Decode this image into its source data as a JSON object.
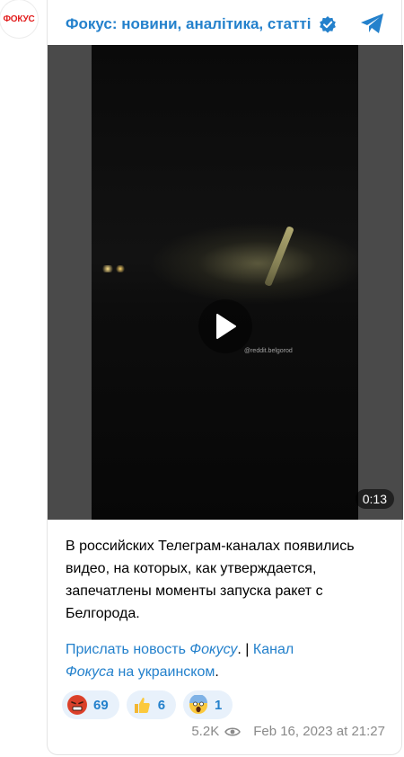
{
  "avatar": {
    "label": "ФОКУС"
  },
  "channel": {
    "title": "Фокус: новини, аналітика, статті",
    "verified_icon": "verified-check-icon",
    "share_icon": "telegram-share-icon"
  },
  "video": {
    "duration": "0:13",
    "watermark": "@reddit.belgorod"
  },
  "post": {
    "text": "В российских Телеграм-каналах появились видео, на которых, как утверждается, запечатлены моменты запуска ракет с Белгорода.",
    "link1_a": "Прислать новость ",
    "link1_b": "Фокусу",
    "sep": ". | ",
    "link2_a": "Канал",
    "link2_b": "Фокуса",
    "link2_c": " на украинском",
    "end": "."
  },
  "reactions": [
    {
      "emoji": "angry-face",
      "count": "69"
    },
    {
      "emoji": "thumbs-up",
      "count": "6"
    },
    {
      "emoji": "screaming-face",
      "count": "1"
    }
  ],
  "meta": {
    "views": "5.2K",
    "date": "Feb 16, 2023 at 21:27"
  },
  "colors": {
    "accent": "#2481cc",
    "reaction_bg": "#e8f1fb",
    "brand_red": "#e21d1d"
  }
}
